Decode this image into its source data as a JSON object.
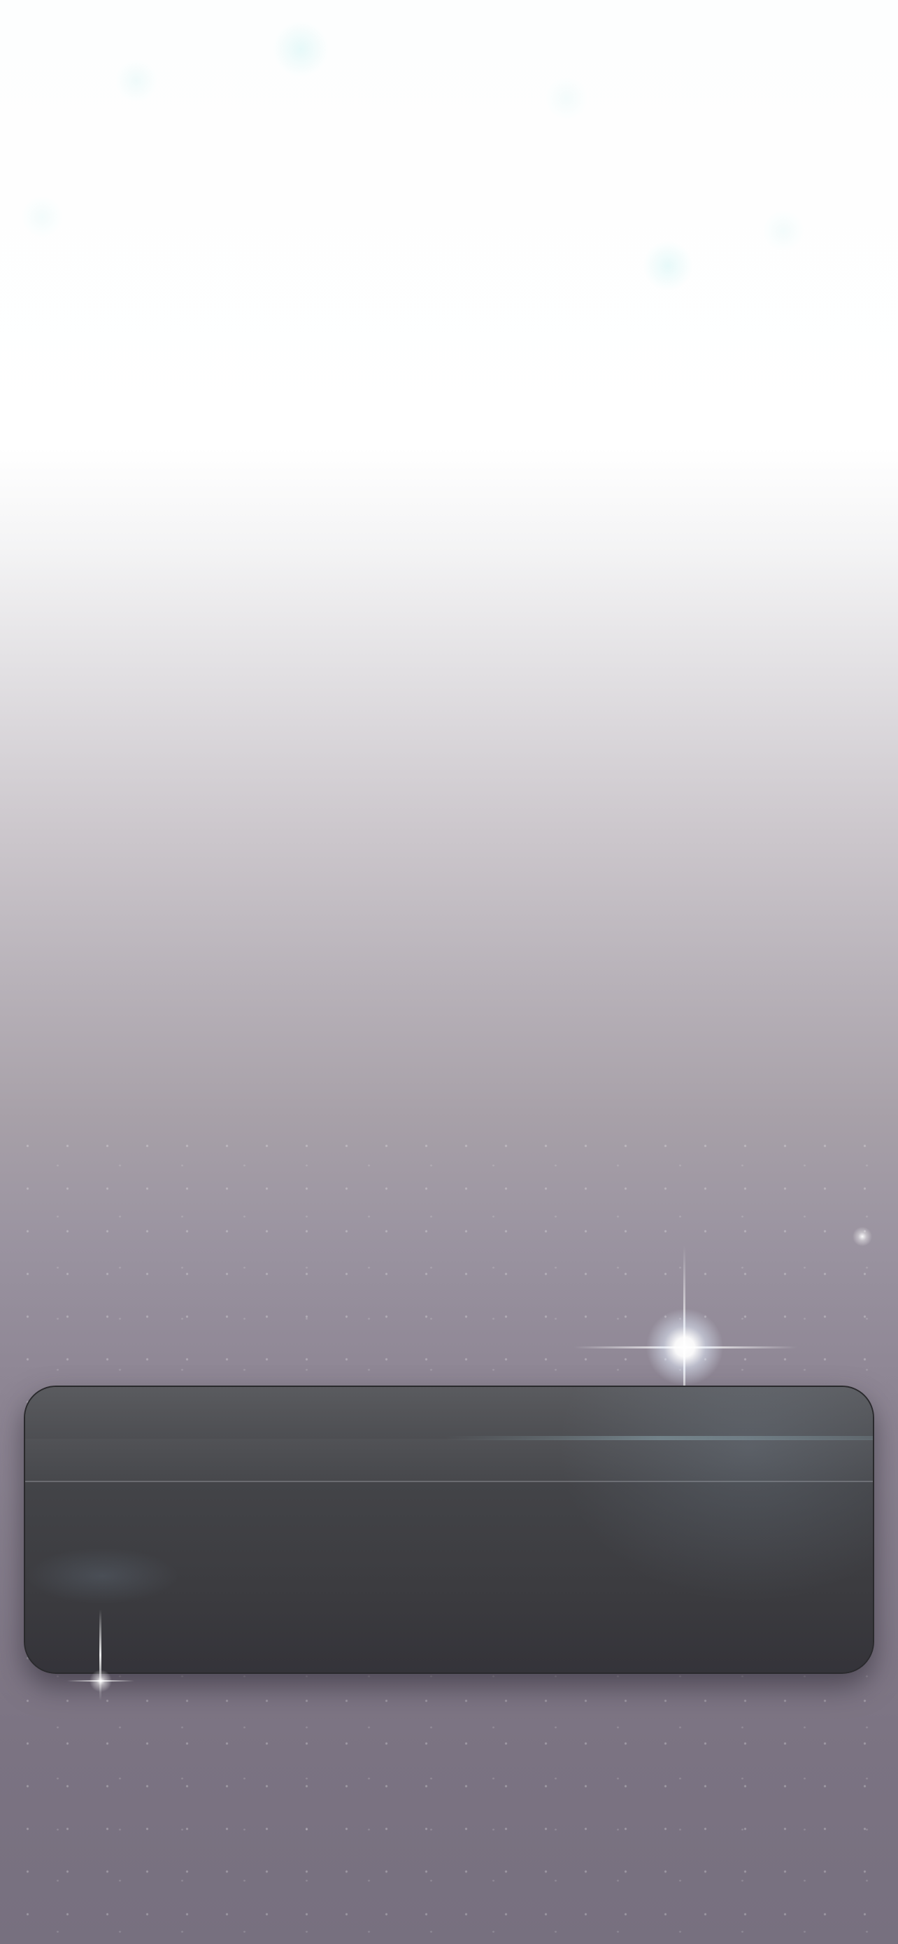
{
  "screen": {
    "background_top_color": "#ffffff",
    "background_bottom_color": "#77707f"
  },
  "panel": {
    "fill_color": "#3b3b3f",
    "header_color": "#5a5b5f",
    "border_color": "#2a2a2d"
  },
  "decorations": {
    "flare_icon": "sparkle-flare",
    "dust_icon": "star-dust"
  }
}
